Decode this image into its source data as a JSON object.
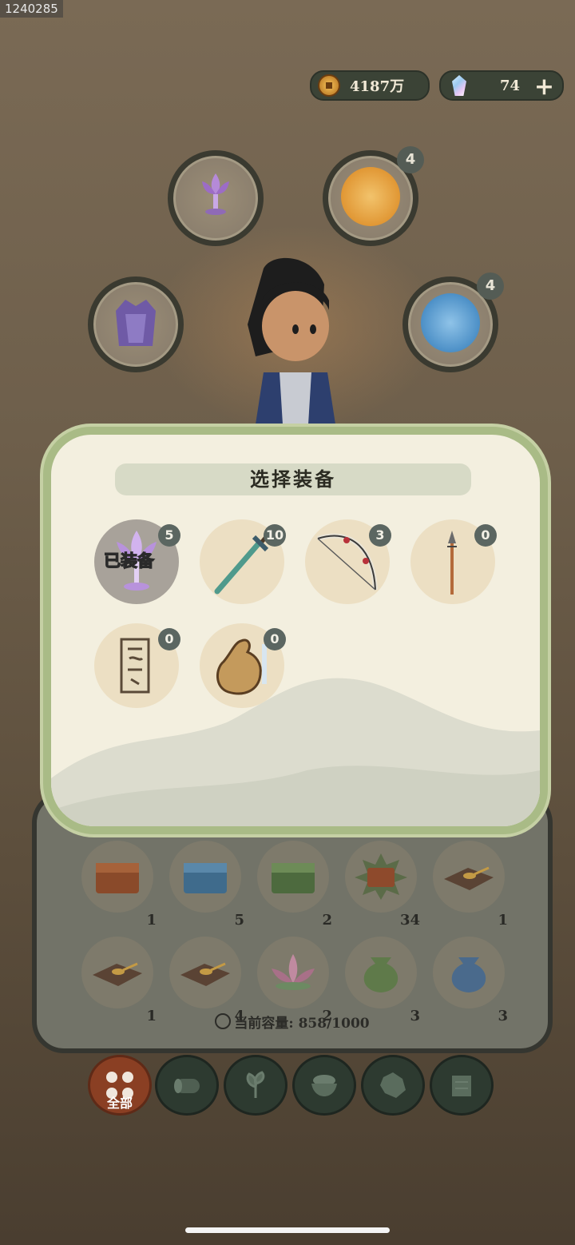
{
  "user_id": "1240285",
  "currency": {
    "coins": "4187万",
    "gems": "74",
    "add_label": "+"
  },
  "equip_slots": [
    {
      "name": "lotus-lamp",
      "badge": ""
    },
    {
      "name": "fire-hero",
      "badge": "4"
    },
    {
      "name": "armor",
      "badge": ""
    },
    {
      "name": "water-hero",
      "badge": "4"
    }
  ],
  "dialog": {
    "title": "选择装备",
    "equipped_label": "已装备",
    "items": [
      {
        "name": "lotus-lamp",
        "count": "5",
        "equipped": true
      },
      {
        "name": "sword",
        "count": "10"
      },
      {
        "name": "bow",
        "count": "3"
      },
      {
        "name": "spear",
        "count": "0"
      },
      {
        "name": "talisman",
        "count": "0"
      },
      {
        "name": "gourd",
        "count": "0"
      }
    ]
  },
  "inventory": {
    "items": [
      {
        "name": "red-chest",
        "count": "1"
      },
      {
        "name": "blue-chest",
        "count": "5"
      },
      {
        "name": "green-chest",
        "count": "2"
      },
      {
        "name": "star-chest",
        "count": "34"
      },
      {
        "name": "spoon-board",
        "count": "1"
      },
      {
        "name": "spoon-board",
        "count": "1"
      },
      {
        "name": "spoon-board",
        "count": "4"
      },
      {
        "name": "lotus",
        "count": "2"
      },
      {
        "name": "green-bag",
        "count": "3"
      },
      {
        "name": "blue-bag",
        "count": "3"
      }
    ],
    "capacity_label": "当前容量:",
    "capacity_value": "858/1000"
  },
  "tabs": [
    {
      "name": "all",
      "label": "全部",
      "active": true
    },
    {
      "name": "wood",
      "label": ""
    },
    {
      "name": "herb",
      "label": ""
    },
    {
      "name": "food",
      "label": ""
    },
    {
      "name": "ore",
      "label": ""
    },
    {
      "name": "scroll",
      "label": ""
    }
  ]
}
